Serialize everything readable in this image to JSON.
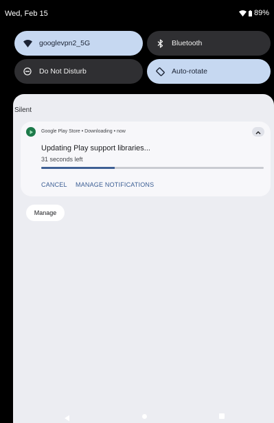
{
  "status_bar": {
    "date": "Wed, Feb 15",
    "battery": "89%"
  },
  "quick_settings": {
    "tiles": [
      {
        "label": "googlevpn2_5G",
        "icon": "wifi-icon",
        "state": "on"
      },
      {
        "label": "Bluetooth",
        "icon": "bluetooth-icon",
        "state": "off"
      },
      {
        "label": "Do Not Disturb",
        "icon": "do-not-disturb-icon",
        "state": "off"
      },
      {
        "label": "Auto-rotate",
        "icon": "auto-rotate-icon",
        "state": "on"
      }
    ]
  },
  "notifications": {
    "section_label": "Silent",
    "card": {
      "header": "Google Play Store • Downloading • now",
      "title": "Updating Play support libraries...",
      "subtitle": "31 seconds left",
      "progress": 0.33,
      "actions": [
        "CANCEL",
        "MANAGE NOTIFICATIONS"
      ]
    },
    "manage_button": "Manage"
  },
  "colors": {
    "accent": "#3a5d93",
    "tile_on": "#c6d8f1",
    "tile_off": "#2f2f32",
    "shade_bg": "#ecedf2"
  }
}
